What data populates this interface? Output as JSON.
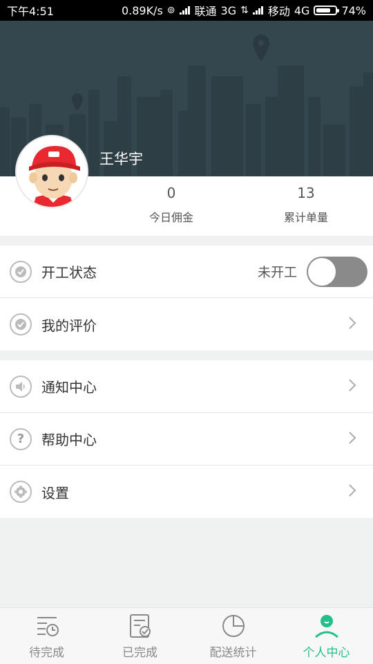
{
  "status_bar": {
    "time": "下午4:51",
    "speed": "0.89K/s",
    "carrier1": "联通",
    "network1": "3G",
    "carrier2": "移动",
    "network2": "4G",
    "battery": "74%",
    "battery_level": 0.74
  },
  "profile": {
    "name": "王华宇",
    "stats": [
      {
        "value": "0",
        "label": "今日佣金"
      },
      {
        "value": "13",
        "label": "累计单量"
      }
    ]
  },
  "menu_group_1": {
    "work_status": {
      "label": "开工状态",
      "state_text": "未开工",
      "toggle_on": false
    },
    "my_rating": {
      "label": "我的评价"
    }
  },
  "menu_group_2": {
    "notification": {
      "label": "通知中心"
    },
    "help": {
      "label": "帮助中心"
    },
    "settings": {
      "label": "设置"
    }
  },
  "tabbar": {
    "tabs": [
      {
        "label": "待完成",
        "icon": "pending-list-icon",
        "active": false
      },
      {
        "label": "已完成",
        "icon": "completed-check-icon",
        "active": false
      },
      {
        "label": "配送统计",
        "icon": "pie-chart-icon",
        "active": false
      },
      {
        "label": "个人中心",
        "icon": "person-icon",
        "active": true
      }
    ],
    "active_color": "#21c08b"
  },
  "colors": {
    "banner": "#34474e",
    "accent": "#21c08b",
    "toggle_off": "#8a8a8a"
  }
}
